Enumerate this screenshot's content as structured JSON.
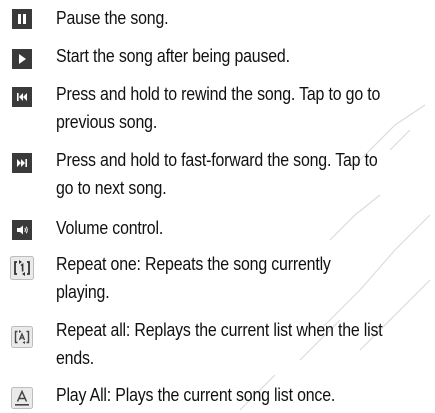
{
  "items": [
    {
      "icon": "pause-icon",
      "lines": [
        "Pause the song."
      ]
    },
    {
      "icon": "play-icon",
      "lines": [
        "Start the song after being paused."
      ]
    },
    {
      "icon": "rewind-icon",
      "lines": [
        "Press and hold to rewind the song. Tap to go to",
        "previous song."
      ]
    },
    {
      "icon": "fast-forward-icon",
      "lines": [
        "Press and hold to fast-forward the song. Tap to",
        "go to next song."
      ]
    },
    {
      "icon": "volume-icon",
      "lines": [
        "Volume control."
      ]
    },
    {
      "icon": "repeat-one-icon",
      "lines": [
        "Repeat one: Repeats the song currently",
        "playing."
      ]
    },
    {
      "icon": "repeat-all-icon",
      "lines": [
        "Repeat all: Replays the current list when the list",
        "ends."
      ]
    },
    {
      "icon": "play-all-icon",
      "lines": [
        "Play All: Plays the current song list once."
      ]
    }
  ],
  "colors": {
    "icon_dark": "#3a3a3a",
    "icon_light": "#e8e8e8",
    "watermark": "#d9d9d9"
  }
}
